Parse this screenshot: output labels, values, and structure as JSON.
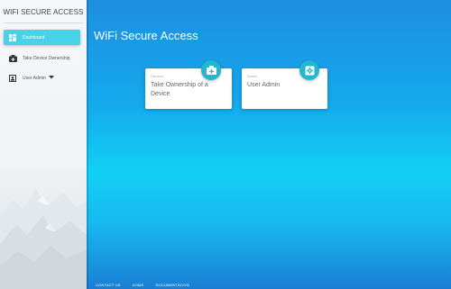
{
  "sidebar": {
    "title": "WIFI SECURE ACCESS",
    "items": [
      {
        "label": "Dashboard",
        "icon": "dashboard-icon",
        "active": true
      },
      {
        "label": "Take Device Ownership",
        "icon": "camera-plus-icon",
        "active": false
      },
      {
        "label": "User Admin",
        "icon": "user-admin-icon",
        "active": false
      }
    ]
  },
  "main": {
    "title": "WiFi Secure Access",
    "cards": [
      {
        "category": "Devices",
        "title": "Take Ownership of a Device",
        "icon": "camera-plus-icon"
      },
      {
        "category": "Admin",
        "title": "User Admin",
        "icon": "settings-icon"
      }
    ]
  },
  "footer": {
    "links": [
      "CONTACT US",
      "HOME",
      "DOCUMENTATION"
    ]
  },
  "colors": {
    "accent": "#47d2e8",
    "badge": "#1fb8cf",
    "main_gradient_top": "#1f8fe0",
    "main_gradient_mid": "#12d0f5"
  }
}
